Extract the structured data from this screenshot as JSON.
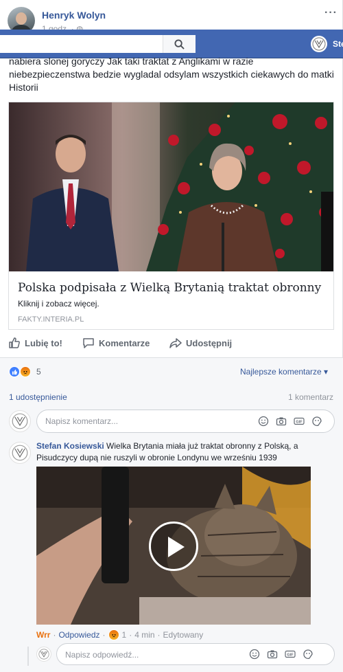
{
  "post": {
    "author": "Henryk Wolyn",
    "time": "1 godz. · ",
    "menu": "···",
    "text": "nabiera slonej goryczy Jak taki traktat z Anglikami w razie niebezpieczenstwa bedzie wygladal odsylam wszystkich ciekawych do matki Historii"
  },
  "topbar": {
    "search_placeholder": "",
    "user_name": "Stefan"
  },
  "link": {
    "title": "Polska podpisała z Wielką Brytanią traktat obronny",
    "subtitle": "Kliknij i zobacz więcej.",
    "domain": "FAKTY.INTERIA.PL"
  },
  "actions": {
    "like": "Lubię to!",
    "comment": "Komentarze",
    "share": "Udostępnij"
  },
  "stats": {
    "reactions_count": "5",
    "sort_label": "Najlepsze komentarze ▾",
    "shares": "1 udostępnienie",
    "comments": "1 komentarz"
  },
  "comment_input": {
    "placeholder": "Napisz komentarz..."
  },
  "comment": {
    "author": "Stefan Kosiewski",
    "text": " Wielka Brytania miała już traktat obronny z Polską, a Pisudczycy dupą nie ruszyli w obronie Londynu we wrześniu 1939",
    "reply_name": "Wrr",
    "reply_label": "Odpowiedz",
    "reaction_count": "1",
    "time": "4 min",
    "edited": "Edytowany"
  },
  "reply_input": {
    "placeholder": "Napisz odpowiedź..."
  },
  "colors": {
    "fb_blue": "#4267b2",
    "link_blue": "#365899",
    "meta_gray": "#90949c"
  }
}
